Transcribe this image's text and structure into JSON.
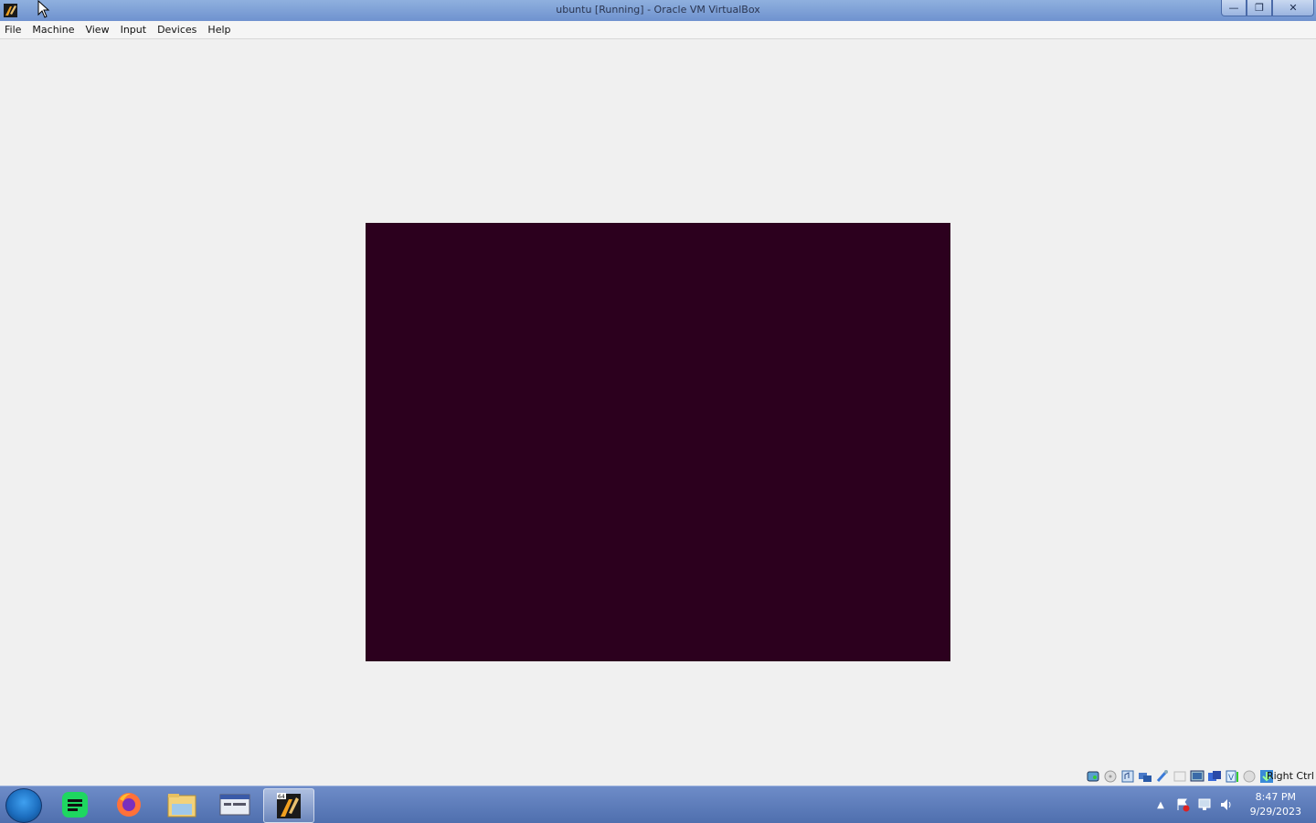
{
  "window": {
    "title": "ubuntu [Running] - Oracle VM VirtualBox",
    "controls": {
      "minimize": "—",
      "maximize": "❐",
      "close": "✕"
    }
  },
  "menubar": {
    "items": [
      {
        "label": "File"
      },
      {
        "label": "Machine"
      },
      {
        "label": "View"
      },
      {
        "label": "Input"
      },
      {
        "label": "Devices"
      },
      {
        "label": "Help"
      }
    ]
  },
  "vm": {
    "screen_color": "#2c001e"
  },
  "statusbar": {
    "icons": [
      "hard-disk-icon",
      "optical-drive-icon",
      "audio-icon",
      "network-icon",
      "usb-icon",
      "shared-folders-icon",
      "display-icon",
      "video-capture-icon",
      "virtualization-icon",
      "cpu-icon",
      "mouse-integration-icon",
      "keyboard-icon"
    ],
    "host_key": "Right Ctrl"
  },
  "taskbar": {
    "apps": [
      {
        "name": "spotify-icon"
      },
      {
        "name": "firefox-icon"
      },
      {
        "name": "file-explorer-icon"
      },
      {
        "name": "remote-desktop-icon"
      },
      {
        "name": "virtualbox-icon",
        "active": true
      }
    ],
    "tray": [
      "show-hidden-icons-icon",
      "action-center-icon",
      "network-icon",
      "volume-icon"
    ],
    "clock": {
      "time": "8:47 PM",
      "date": "9/29/2023"
    }
  }
}
